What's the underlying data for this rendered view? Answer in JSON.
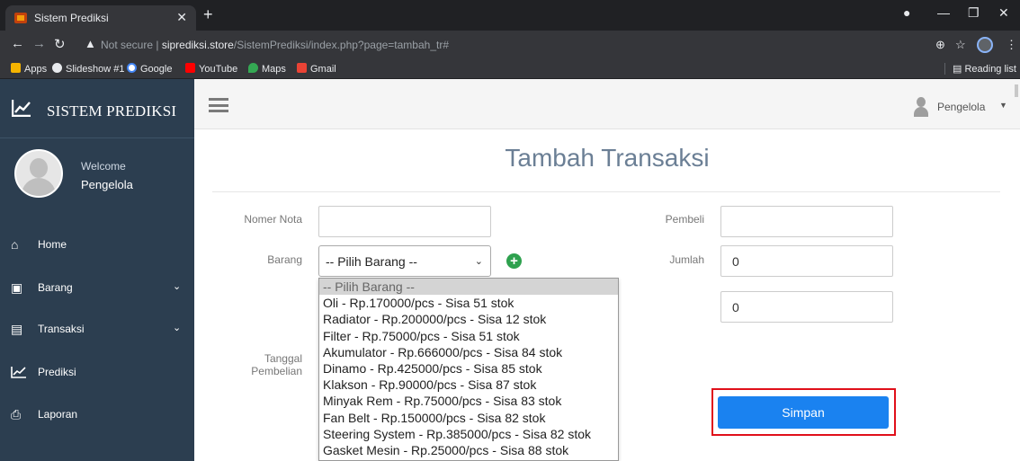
{
  "browser": {
    "tab_title": "Sistem Prediksi",
    "not_secure": "Not secure",
    "url_host": "siprediksi.store",
    "url_path": "/SistemPrediksi/index.php?page=tambah_tr#",
    "bookmarks": [
      "Apps",
      "Slideshow #1",
      "Google",
      "YouTube",
      "Maps",
      "Gmail"
    ],
    "reading_list": "Reading list"
  },
  "sidebar": {
    "brand": "SISTEM PREDIKSI",
    "welcome": "Welcome",
    "username": "Pengelola",
    "menu": [
      {
        "label": "Home",
        "icon": "home-icon"
      },
      {
        "label": "Barang",
        "icon": "briefcase-icon"
      },
      {
        "label": "Transaksi",
        "icon": "card-icon"
      },
      {
        "label": "Prediksi",
        "icon": "chart-icon"
      },
      {
        "label": "Laporan",
        "icon": "printer-icon"
      }
    ]
  },
  "topbar": {
    "user_label": "Pengelola"
  },
  "page": {
    "title": "Tambah Transaksi"
  },
  "form": {
    "nomer_nota_label": "Nomer Nota",
    "nomer_nota_value": "",
    "barang_label": "Barang",
    "barang_selected": "-- Pilih Barang --",
    "tanggal_label_1": "Tanggal",
    "tanggal_label_2": "Pembelian",
    "pembeli_label": "Pembeli",
    "pembeli_value": "",
    "jumlah_label": "Jumlah",
    "jumlah_value": "0",
    "total_value": "0",
    "submit_label": "Simpan"
  },
  "dropdown_options": [
    "-- Pilih Barang --",
    "Oli - Rp.170000/pcs - Sisa 51 stok",
    "Radiator - Rp.200000/pcs - Sisa 12 stok",
    "Filter - Rp.75000/pcs - Sisa 51 stok",
    "Akumulator - Rp.666000/pcs - Sisa 84 stok",
    "Dinamo - Rp.425000/pcs - Sisa 85 stok",
    "Klakson - Rp.90000/pcs - Sisa 87 stok",
    "Minyak Rem - Rp.75000/pcs - Sisa 83 stok",
    "Fan Belt - Rp.150000/pcs - Sisa 82 stok",
    "Steering System - Rp.385000/pcs - Sisa 82 stok",
    "Gasket Mesin - Rp.25000/pcs - Sisa 88 stok"
  ],
  "colors": {
    "sidebar_bg": "#2c3e50",
    "accent_button": "#1a82f0",
    "highlight": "#e0101a",
    "title": "#6b7f95"
  }
}
